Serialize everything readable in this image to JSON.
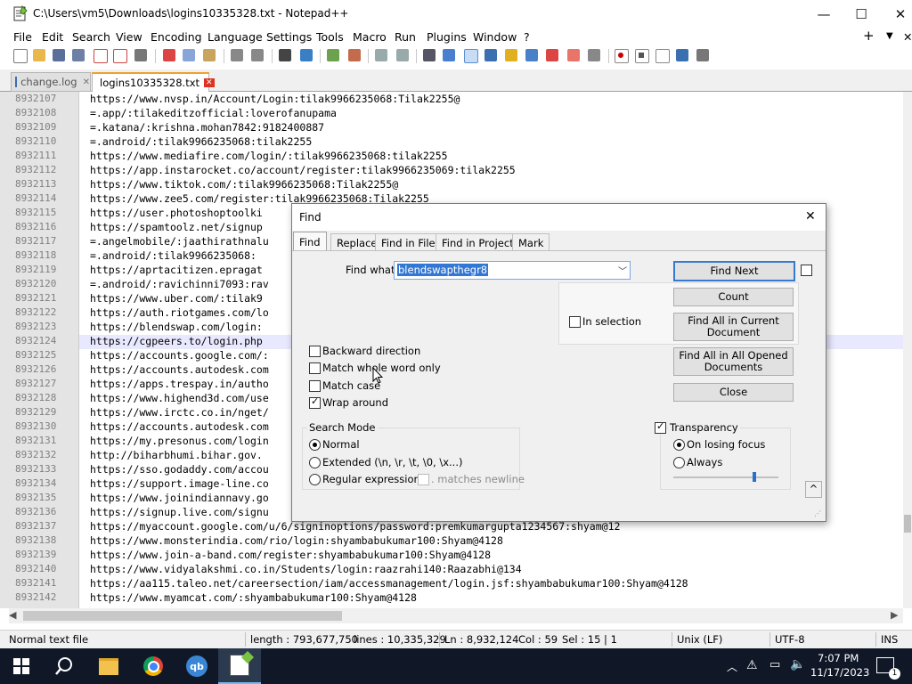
{
  "window": {
    "title": "C:\\Users\\vm5\\Downloads\\logins10335328.txt - Notepad++",
    "minimize": "—",
    "maximize": "☐",
    "close": "✕"
  },
  "menu": [
    "File",
    "Edit",
    "Search",
    "View",
    "Encoding",
    "Language",
    "Settings",
    "Tools",
    "Macro",
    "Run",
    "Plugins",
    "Window",
    "?"
  ],
  "menu_right": {
    "add": "+",
    "dropdown": "▼",
    "close": "✕"
  },
  "tabs": [
    {
      "label": "change.log"
    },
    {
      "label": "logins10335328.txt"
    }
  ],
  "editor": {
    "line_numbers": [
      "8932107",
      "8932108",
      "8932109",
      "8932110",
      "8932111",
      "8932112",
      "8932113",
      "8932114",
      "8932115",
      "8932116",
      "8932117",
      "8932118",
      "8932119",
      "8932120",
      "8932121",
      "8932122",
      "8932123",
      "8932124",
      "8932125",
      "8932126",
      "8932127",
      "8932128",
      "8932129",
      "8932130",
      "8932131",
      "8932132",
      "8932133",
      "8932134",
      "8932135",
      "8932136",
      "8932137",
      "8932138",
      "8932139",
      "8932140",
      "8932141",
      "8932142"
    ],
    "lines": [
      "https://www.nvsp.in/Account/Login:tilak9966235068:Tilak2255@",
      "=.app/:tilakeditzofficial:loverofanupama",
      "=.katana/:krishna.mohan7842:9182400887",
      "=.android/:tilak9966235068:tilak2255",
      "https://www.mediafire.com/login/:tilak9966235068:tilak2255",
      "https://app.instarocket.co/account/register:tilak9966235069:tilak2255",
      "https://www.tiktok.com/:tilak9966235068:Tilak2255@",
      "https://www.zee5.com/register:tilak9966235068:Tilak2255",
      "https://user.photoshoptoolki",
      "https://spamtoolz.net/signup",
      "=.angelmobile/:jaathirathnalu",
      "=.android/:tilak9966235068:",
      "https://aprtacitizen.epragat",
      "=.android/:ravichinni7093:rav",
      "https://www.uber.com/:tilak9",
      "https://auth.riotgames.com/lo",
      "https://blendswap.com/login:",
      "https://cgpeers.to/login.php",
      "https://accounts.google.com/:",
      "https://accounts.autodesk.com",
      "https://apps.trespay.in/autho",
      "https://www.highend3d.com/use",
      "https://www.irctc.co.in/nget/",
      "https://accounts.autodesk.com",
      "https://my.presonus.com/login",
      "http://biharbhumi.bihar.gov.",
      "https://sso.godaddy.com/accou",
      "https://support.image-line.co",
      "https://www.joinindiannavy.go",
      "https://signup.live.com/signu",
      "https://myaccount.google.com/u/6/signinoptions/password:premkumargupta1234567:shyam@12",
      "https://www.monsterindia.com/rio/login:shyambabukumar100:Shyam@4128",
      "https://www.join-a-band.com/register:shyambabukumar100:Shyam@4128",
      "https://www.vidyalakshmi.co.in/Students/login:raazrahi140:Raazabhi@134",
      "https://aa115.taleo.net/careersection/iam/accessmanagement/login.jsf:shyambabukumar100:Shyam@4128",
      "https://www.myamcat.com/:shyambabukumar100:Shyam@4128"
    ]
  },
  "status": {
    "filetype": "Normal text file",
    "length": "length : 793,677,750",
    "lines": "lines : 10,335,329",
    "position": "Ln : 8,932,124",
    "col": "Col : 59",
    "sel": "Sel : 15 | 1",
    "eol": "Unix (LF)",
    "encoding": "UTF-8",
    "mode": "INS"
  },
  "taskbar": {
    "time": "7:07 PM",
    "date": "11/17/2023",
    "notification_count": "1"
  },
  "find_dialog": {
    "title": "Find",
    "close": "✕",
    "tabs": [
      "Find",
      "Replace",
      "Find in Files",
      "Find in Projects",
      "Mark"
    ],
    "find_what_label": "Find what :",
    "find_what_value": "blendswapthegr8",
    "buttons": {
      "find_next": "Find Next",
      "count": "Count",
      "find_all_current": "Find All in Current Document",
      "find_all_opened": "Find All in All Opened Documents",
      "close": "Close"
    },
    "in_selection": "In selection",
    "options": {
      "backward": {
        "label": "Backward direction",
        "checked": false
      },
      "whole_word": {
        "label": "Match whole word only",
        "checked": false
      },
      "match_case": {
        "label": "Match case",
        "checked": false
      },
      "wrap_around": {
        "label": "Wrap around",
        "checked": true
      }
    },
    "search_mode": {
      "label": "Search Mode",
      "normal": "Normal",
      "extended": "Extended (\\n, \\r, \\t, \\0, \\x...)",
      "regex": "Regular expression",
      "matches_newline": ". matches newline",
      "selected": "normal"
    },
    "transparency": {
      "label": "Transparency",
      "checked": true,
      "on_losing_focus": "On losing focus",
      "always": "Always",
      "selected": "on_losing_focus",
      "level": 0.78
    },
    "collapse": "^"
  }
}
